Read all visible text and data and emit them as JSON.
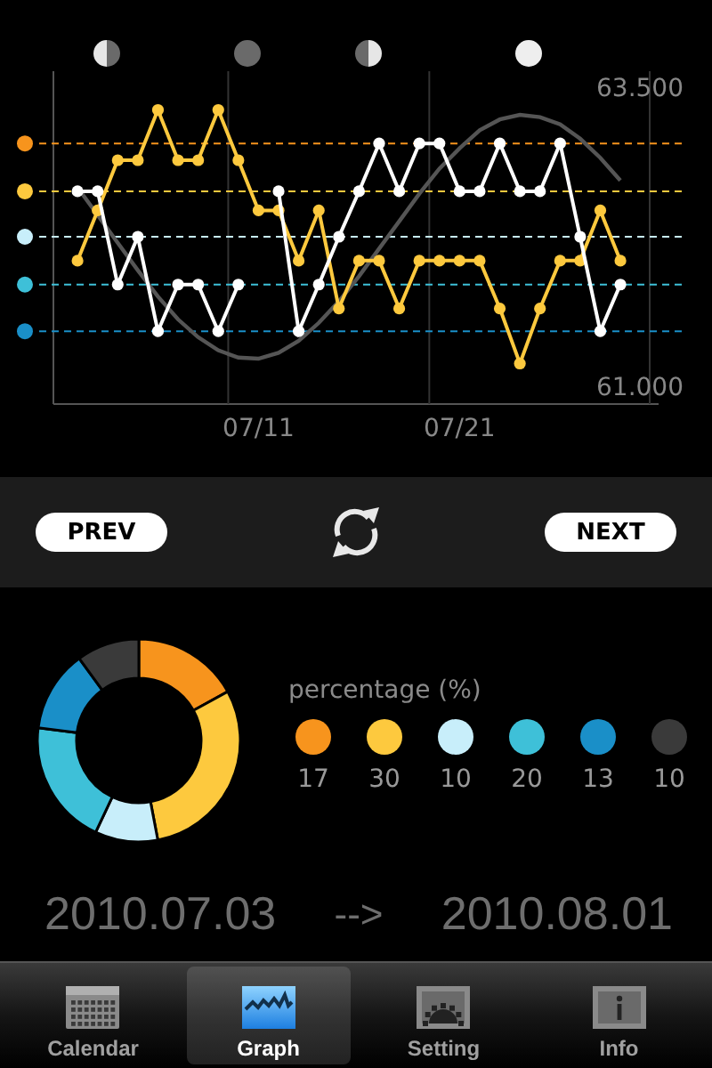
{
  "chart": {
    "moons": [
      {
        "kind": "last_quarter"
      },
      {
        "kind": "new"
      },
      {
        "kind": "first_quarter"
      },
      {
        "kind": "full"
      }
    ],
    "chart_data": {
      "type": "line",
      "categories": [
        null,
        null,
        null,
        null,
        null,
        null,
        null,
        null,
        null,
        "07/11",
        null,
        null,
        null,
        null,
        null,
        null,
        null,
        null,
        null,
        "07/21",
        null,
        null,
        null,
        null,
        null,
        null,
        null,
        null
      ],
      "ref_lines": [
        {
          "axis": "y",
          "value": 63.03,
          "color": "#f7941d"
        },
        {
          "axis": "y",
          "value": 62.63,
          "color": "#fdc93e"
        },
        {
          "axis": "y",
          "value": 62.25,
          "color": "#c8eefa"
        },
        {
          "axis": "y",
          "value": 61.85,
          "color": "#3ec0d8"
        },
        {
          "axis": "y",
          "value": 61.46,
          "color": "#1a8fc8"
        }
      ],
      "ylim": [
        61,
        63.5
      ],
      "yticks": [
        {
          "value": 61,
          "label": "61.000"
        },
        {
          "value": 63.5,
          "label": "63.500"
        }
      ],
      "series": [
        {
          "color": "#555555",
          "values": [
            62.66,
            62.43,
            62.2,
            61.97,
            61.75,
            61.56,
            61.41,
            61.3,
            61.24,
            61.23,
            61.28,
            61.38,
            61.53,
            61.71,
            61.92,
            62.15,
            62.38,
            62.61,
            62.82,
            62.99,
            63.14,
            63.23,
            63.27,
            63.25,
            63.19,
            63.07,
            62.91,
            62.72
          ]
        },
        {
          "color": "#fdc93e",
          "marker": "o",
          "values": [
            62.05,
            62.47,
            62.89,
            62.89,
            63.31,
            62.89,
            62.89,
            63.31,
            62.89,
            62.47,
            62.47,
            62.05,
            62.47,
            61.65,
            62.05,
            62.05,
            61.65,
            62.05,
            62.05,
            62.05,
            62.05,
            61.65,
            61.19,
            61.65,
            62.05,
            62.05,
            62.47,
            62.05
          ]
        },
        {
          "color": "#ffffff",
          "marker": "o",
          "values": [
            62.63,
            62.63,
            61.85,
            62.25,
            61.46,
            61.85,
            61.85,
            61.46,
            61.85,
            null,
            62.63,
            61.46,
            61.85,
            62.25,
            62.63,
            63.03,
            62.63,
            63.03,
            63.03,
            62.63,
            62.63,
            63.03,
            62.63,
            62.63,
            63.03,
            62.25,
            61.46,
            61.85
          ]
        }
      ]
    }
  },
  "nav": {
    "prev": "PREV",
    "next": "NEXT"
  },
  "summary": {
    "chart_data": {
      "type": "donut",
      "values": [
        17,
        30,
        10,
        20,
        13,
        10
      ]
    },
    "legend": {
      "title": "percentage (%)",
      "items": [
        {
          "color": "#f7941d",
          "label": "17"
        },
        {
          "color": "#fdc93e",
          "label": "30"
        },
        {
          "color": "#c8eefa",
          "label": "10"
        },
        {
          "color": "#3ec0d8",
          "label": "20"
        },
        {
          "color": "#1a8fc8",
          "label": "13"
        },
        {
          "color": "#3a3a3a",
          "label": "10"
        }
      ]
    }
  },
  "range": {
    "start": "2010.07.03",
    "arrow": "-->",
    "end": "2010.08.01"
  },
  "tabs": [
    {
      "label": "Calendar",
      "kind": "calendar",
      "selected": false
    },
    {
      "label": "Graph",
      "kind": "graph",
      "selected": true
    },
    {
      "label": "Setting",
      "kind": "setting",
      "selected": false
    },
    {
      "label": "Info",
      "kind": "info",
      "selected": false
    }
  ]
}
